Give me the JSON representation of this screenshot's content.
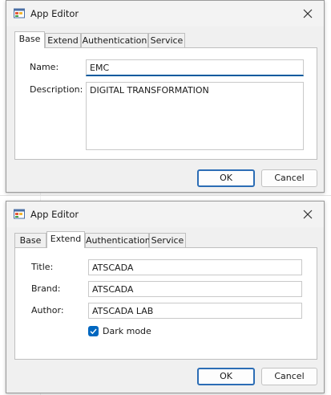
{
  "dialog1": {
    "title": "App Editor",
    "tabs": [
      "Base",
      "Extend",
      "Authentication",
      "Service"
    ],
    "active_tab": "Base",
    "fields": {
      "name_label": "Name:",
      "name_value": "EMC",
      "description_label": "Description:",
      "description_value": "DIGITAL TRANSFORMATION"
    },
    "ok_label": "OK",
    "cancel_label": "Cancel"
  },
  "dialog2": {
    "title": "App Editor",
    "tabs": [
      "Base",
      "Extend",
      "Authentication",
      "Service"
    ],
    "active_tab": "Extend",
    "fields": {
      "title_label": "Title:",
      "title_value": "ATSCADA",
      "brand_label": "Brand:",
      "brand_value": "ATSCADA",
      "author_label": "Author:",
      "author_value": "ATSCADA LAB"
    },
    "dark_mode_label": "Dark mode",
    "dark_mode_checked": true,
    "ok_label": "OK",
    "cancel_label": "Cancel"
  },
  "colors": {
    "accent": "#0067c0",
    "focus_underline": "#005a9e",
    "default_button_border": "#2c6db5",
    "window_bg": "#f0f0f0",
    "panel_bg": "#ffffff"
  },
  "icons": {
    "app": "app-window-icon",
    "close": "close-icon",
    "check": "checkmark-icon"
  }
}
